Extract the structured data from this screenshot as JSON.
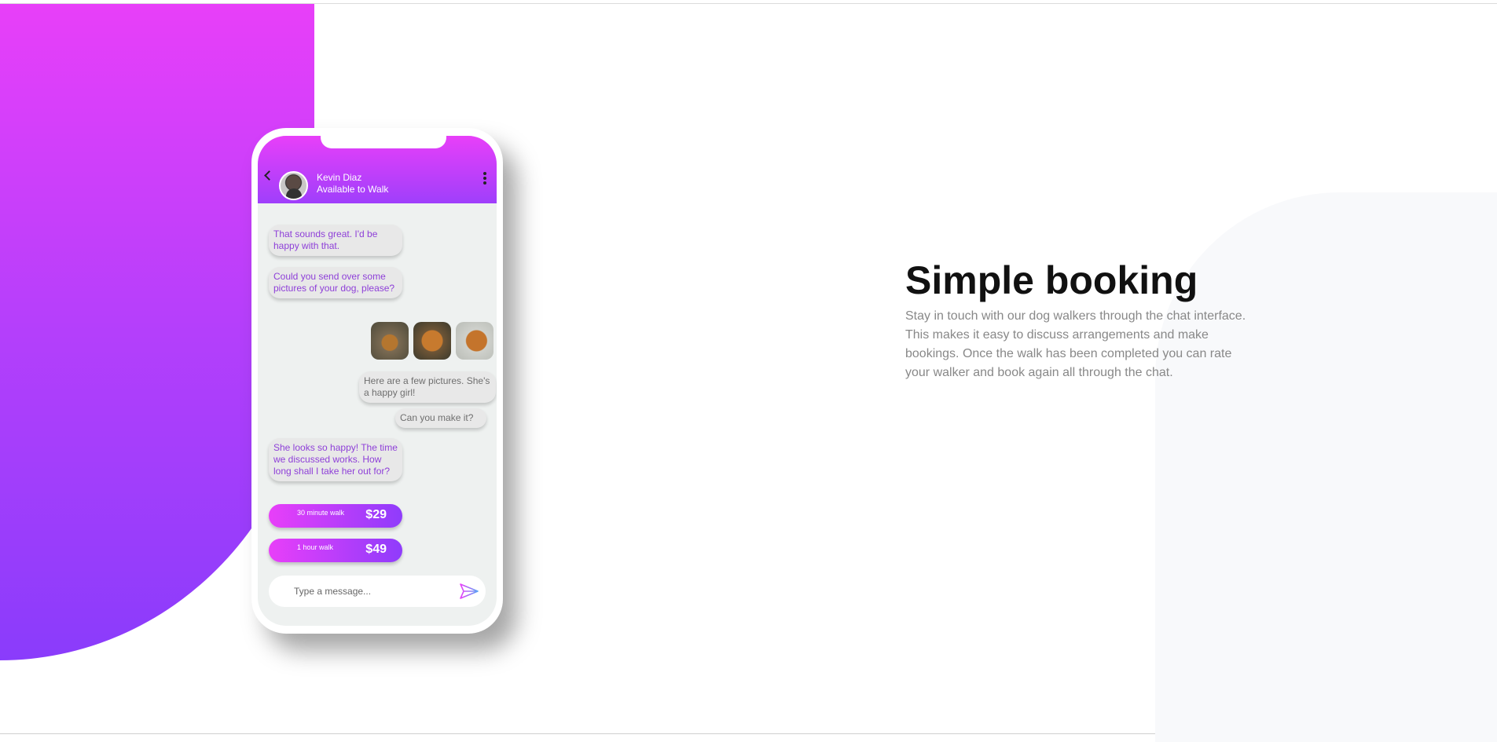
{
  "chat": {
    "contact_name": "Kevin Diaz",
    "contact_status": "Available to Walk",
    "messages": [
      {
        "side": "in",
        "text": "That sounds great. I'd be happy with that."
      },
      {
        "side": "in",
        "text": "Could you send over some pictures of your dog, please?"
      },
      {
        "side": "out",
        "text": "Here are a few pictures. She's a happy girl!"
      },
      {
        "side": "out",
        "text": "Can you make it?"
      },
      {
        "side": "in",
        "text": "She looks so happy! The time we discussed works. How long shall I take her out for?"
      }
    ],
    "options": [
      {
        "label": "30 minute walk",
        "price": "$29"
      },
      {
        "label": "1 hour walk",
        "price": "$49"
      }
    ],
    "input_placeholder": "Type a message..."
  },
  "feature": {
    "title": "Simple booking",
    "description": "Stay in touch with our dog walkers through the chat interface. This makes it easy to discuss arrangements and make bookings. Once the walk has been completed you can rate your walker and book again all through the chat."
  },
  "colors": {
    "accent_pink": "#e83ff9",
    "accent_purple": "#8a3cfb",
    "chat_background": "#eef1f0",
    "incoming_text": "#8e3fd8"
  },
  "icons": [
    "back-arrow-icon",
    "avatar",
    "more-vertical-icon",
    "send-icon"
  ]
}
